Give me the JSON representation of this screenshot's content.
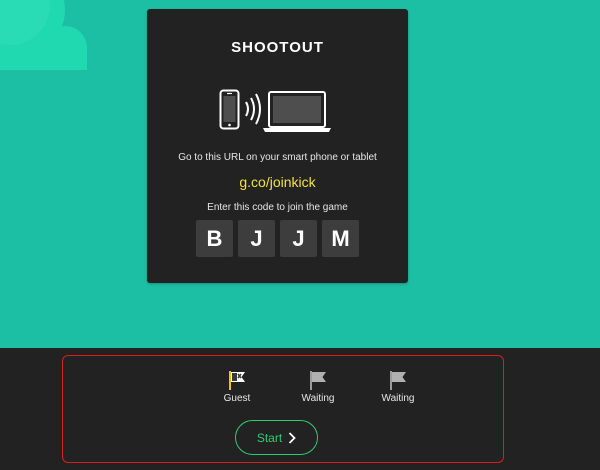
{
  "card": {
    "title": "SHOOTOUT",
    "url_instruction": "Go to this URL on your smart phone or tablet",
    "url": "g.co/joinkick",
    "code_instruction": "Enter this code to join the game",
    "code": [
      "B",
      "J",
      "J",
      "M"
    ]
  },
  "players": [
    {
      "label": "Guest",
      "icon": "guest-flag-icon"
    },
    {
      "label": "Waiting",
      "icon": "waiting-flag-icon"
    },
    {
      "label": "Waiting",
      "icon": "waiting-flag-icon"
    }
  ],
  "start": {
    "label": "Start"
  },
  "colors": {
    "background": "#1cbfa3",
    "card": "#222222",
    "code_box": "#3d3d3d",
    "url": "#f1e33a",
    "start": "#2ecc71",
    "highlight_border": "#d61f1f"
  }
}
